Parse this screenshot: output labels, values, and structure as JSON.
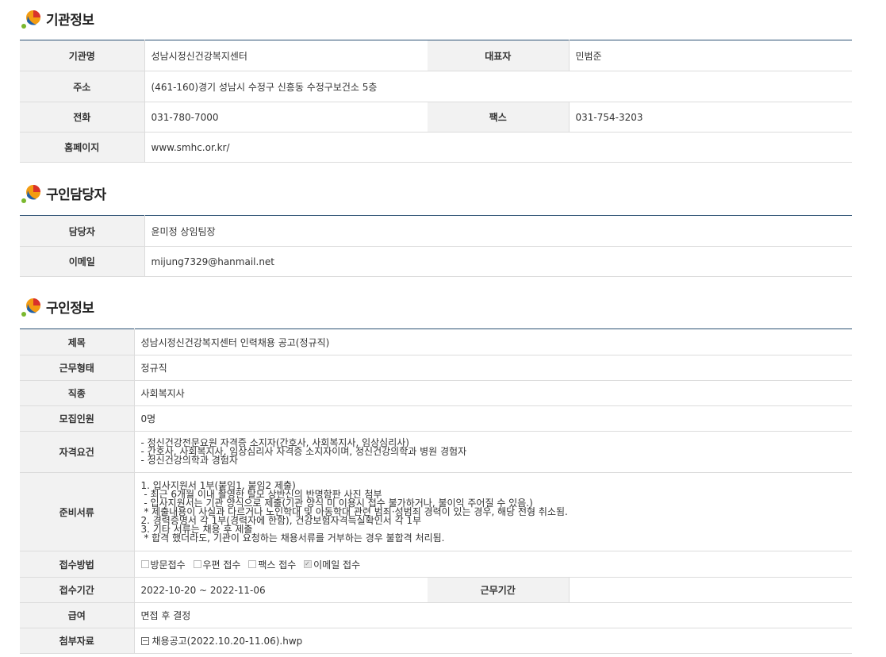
{
  "sections": {
    "org": {
      "title": "기관정보",
      "rows": {
        "name_label": "기관명",
        "name": "성남시정신건강복지센터",
        "rep_label": "대표자",
        "rep": "민범준",
        "addr_label": "주소",
        "addr": "(461-160)경기 성남시 수정구 신흥동 수정구보건소 5층",
        "tel_label": "전화",
        "tel": "031-780-7000",
        "fax_label": "팩스",
        "fax": "031-754-3203",
        "home_label": "홈페이지",
        "home": "www.smhc.or.kr/"
      }
    },
    "contact": {
      "title": "구인담당자",
      "rows": {
        "person_label": "담당자",
        "person": "윤미정 상임팀장",
        "email_label": "이메일",
        "email": "mijung7329@hanmail.net"
      }
    },
    "job": {
      "title": "구인정보",
      "rows": {
        "subject_label": "제목",
        "subject": "성남시정신건강복지센터 인력채용 공고(정규직)",
        "worktype_label": "근무형태",
        "worktype": "정규직",
        "category_label": "직종",
        "category": "사회복지사",
        "headcount_label": "모집인원",
        "headcount": "0명",
        "qual_label": "자격요건",
        "qual": "- 정신건강전문요원 자격증 소지자(간호사, 사회복지사, 임상심리사)\n- 간호사, 사회복지사, 임상심리사 자격증 소지자이며, 정신건강의학과 병원 경험자\n- 정신건강의학과 경험자",
        "docs_label": "준비서류",
        "docs": "1. 입사지원서 1부(붙임1, 붙임2 제출)\n - 최근 6개월 이내 촬영한 탈모 상반신의 반명함판 사진 첨부\n - 입사지원서는 기관 양식으로 제출(기관 양식 미 이용시 접수 불가하거나, 불이익 주어질 수 있음.)\n * 제출내용이 사실과 다르거나 노인학대 및 아동학대 관련 범죄·성범죄 경력이 있는 경우, 해당 전형 취소됨.\n2. 경력증명서 각 1부(경력자에 한함), 건강보험자격득실확인서 각 1부\n3. 기타 서류는 채용 후 제출\n * 합격 했더라도, 기관이 요청하는 채용서류를 거부하는 경우 불합격 처리됨.",
        "method_label": "접수방법",
        "methods": [
          {
            "label": "방문접수",
            "checked": false
          },
          {
            "label": "우편 접수",
            "checked": false
          },
          {
            "label": "팩스 접수",
            "checked": false
          },
          {
            "label": "이메일 접수",
            "checked": true
          }
        ],
        "period_label": "접수기간",
        "period": "2022-10-20 ~ 2022-11-06",
        "workperiod_label": "근무기간",
        "workperiod": "",
        "salary_label": "급여",
        "salary": "면접 후 결정",
        "attach_label": "첨부자료",
        "attach": "채용공고(2022.10.20-11.06).hwp"
      }
    }
  },
  "colors": {
    "header_rule": "#2b5073",
    "th_bg": "#f2f2f2"
  }
}
